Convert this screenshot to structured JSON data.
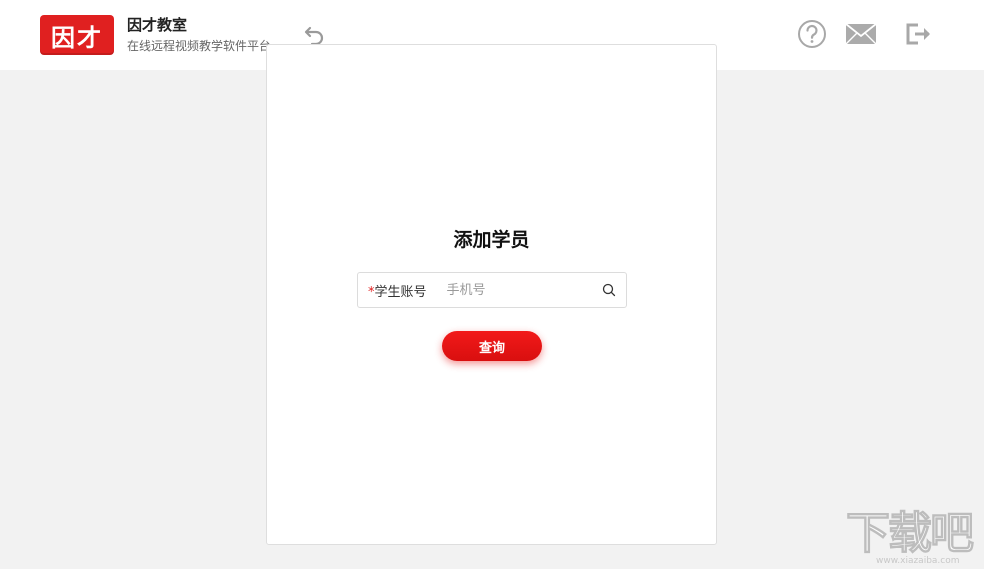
{
  "header": {
    "logo_text": "因才",
    "brand_name": "因才教室",
    "brand_subtitle": "在线远程视频教学软件平台",
    "icons": {
      "back": "undo-arrow-icon",
      "help": "question-circle-icon",
      "mail": "envelope-icon",
      "logout": "logout-icon"
    }
  },
  "dialog": {
    "title": "添加学员",
    "field": {
      "required_mark": "*",
      "label": "学生账号",
      "placeholder": "手机号",
      "value": ""
    },
    "query_button_label": "查询"
  },
  "watermark": {
    "text": "下载吧",
    "url": "www.xiazaiba.com"
  },
  "colors": {
    "accent": "#e02020",
    "background": "#f2f2f2",
    "panel": "#ffffff"
  }
}
